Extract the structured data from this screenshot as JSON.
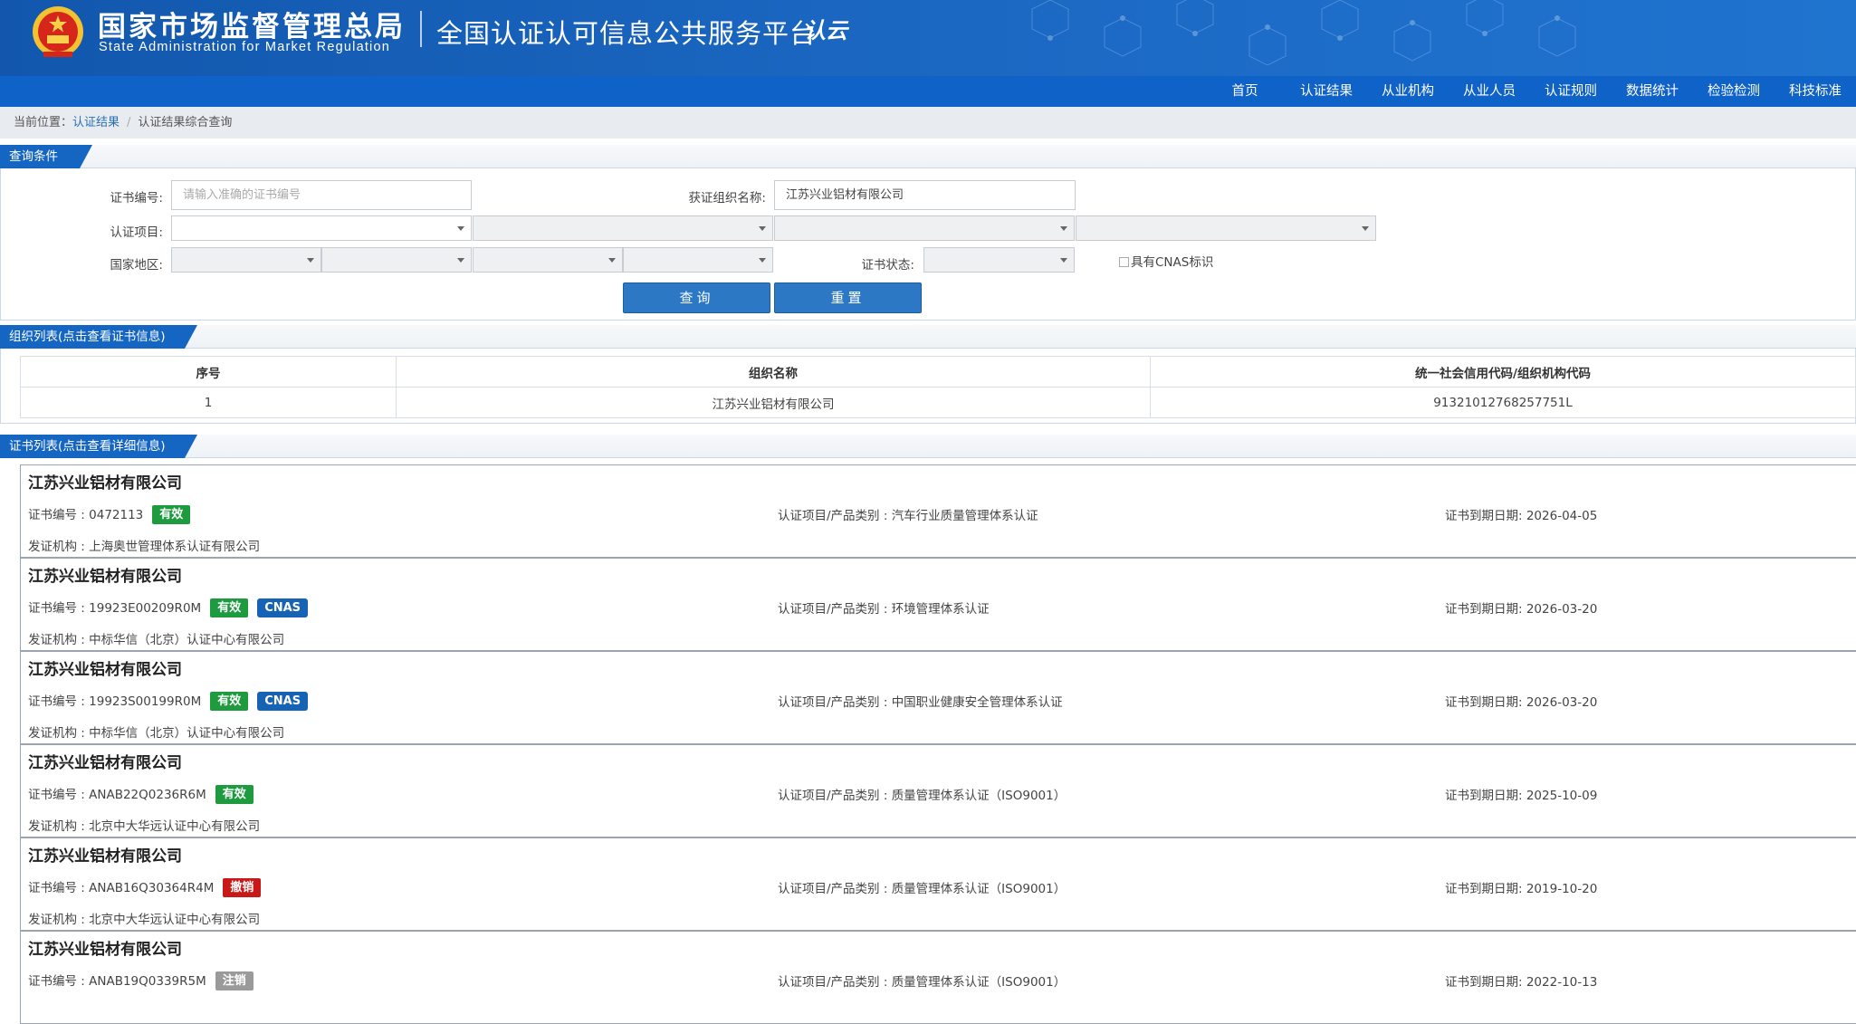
{
  "header": {
    "org_cn": "国家市场监督管理总局",
    "org_en": "State Administration  for  Market Regulation",
    "platform": "全国认证认可信息公共服务平台",
    "cloud_logo": "认云"
  },
  "nav": [
    "首页",
    "认证结果",
    "从业机构",
    "从业人员",
    "认证规则",
    "数据统计",
    "检验检测",
    "科技标准"
  ],
  "breadcrumb": {
    "prefix": "当前位置：",
    "link": "认证结果",
    "current": "认证结果综合查询"
  },
  "query": {
    "section_title": "查询条件",
    "cert_no_label": "证书编号:",
    "cert_no_placeholder": "请输入准确的证书编号",
    "org_label": "获证组织名称:",
    "org_value": "江苏兴业铝材有限公司",
    "item_label": "认证项目:",
    "region_label": "国家地区:",
    "status_label": "证书状态:",
    "cnas_label": "具有CNAS标识",
    "search_btn": "查询",
    "reset_btn": "重置"
  },
  "org_list": {
    "section_title": "组织列表(点击查看证书信息)",
    "columns": [
      "序号",
      "组织名称",
      "统一社会信用代码/组织机构代码"
    ],
    "rows": [
      [
        "1",
        "江苏兴业铝材有限公司",
        "91321012768257751L"
      ]
    ]
  },
  "cert_list": {
    "section_title": "证书列表(点击查看详细信息)",
    "no_prefix": "证书编号 : ",
    "item_prefix": "认证项目/产品类别 : ",
    "expire_prefix": "证书到期日期: ",
    "issuer_prefix": "发证机构 : ",
    "certs": [
      {
        "org": "江苏兴业铝材有限公司",
        "no": "0472113",
        "status": "有效",
        "status_type": "valid",
        "cnas": "",
        "item": "汽车行业质量管理体系认证",
        "expire": "2026-04-05",
        "issuer": "上海奥世管理体系认证有限公司"
      },
      {
        "org": "江苏兴业铝材有限公司",
        "no": "19923E00209R0M",
        "status": "有效",
        "status_type": "valid",
        "cnas": "CNAS",
        "item": "环境管理体系认证",
        "expire": "2026-03-20",
        "issuer": "中标华信（北京）认证中心有限公司"
      },
      {
        "org": "江苏兴业铝材有限公司",
        "no": "19923S00199R0M",
        "status": "有效",
        "status_type": "valid",
        "cnas": "CNAS",
        "item": "中国职业健康安全管理体系认证",
        "expire": "2026-03-20",
        "issuer": "中标华信（北京）认证中心有限公司"
      },
      {
        "org": "江苏兴业铝材有限公司",
        "no": "ANAB22Q0236R6M",
        "status": "有效",
        "status_type": "valid",
        "cnas": "",
        "item": "质量管理体系认证（ISO9001）",
        "expire": "2025-10-09",
        "issuer": "北京中大华远认证中心有限公司"
      },
      {
        "org": "江苏兴业铝材有限公司",
        "no": "ANAB16Q30364R4M",
        "status": "撤销",
        "status_type": "revoked",
        "cnas": "",
        "item": "质量管理体系认证（ISO9001）",
        "expire": "2019-10-20",
        "issuer": "北京中大华远认证中心有限公司"
      },
      {
        "org": "江苏兴业铝材有限公司",
        "no": "ANAB19Q0339R5M",
        "status": "注销",
        "status_type": "cancel",
        "cnas": "",
        "item": "质量管理体系认证（ISO9001）",
        "expire": "2022-10-13",
        "issuer": ""
      }
    ]
  },
  "colors": {
    "banner": "#1257ad",
    "nav": "#0f62c8",
    "section_tab": "#1466c2",
    "button": "#2c78c5",
    "valid": "#1e9a3f",
    "revoked": "#c81818",
    "cancelled": "#9a9a9a",
    "cnas": "#1662b4"
  }
}
